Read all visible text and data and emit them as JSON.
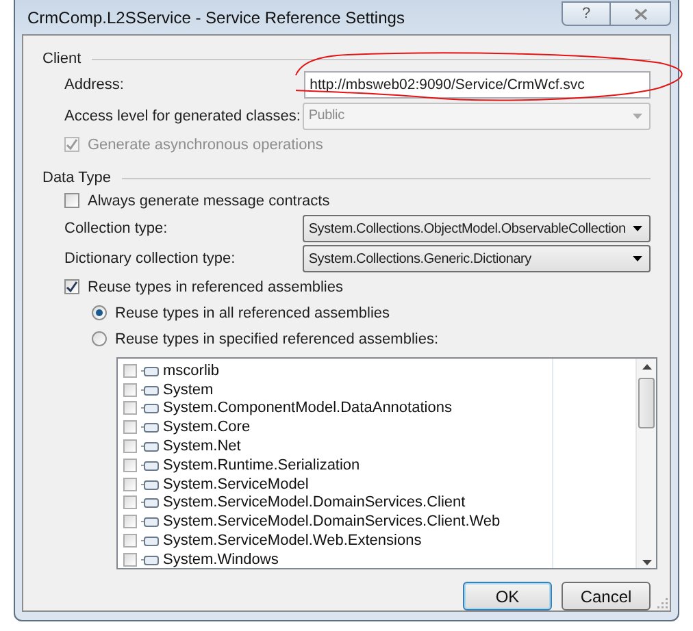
{
  "window": {
    "title": "CrmComp.L2SService - Service Reference Settings",
    "help": "?"
  },
  "client": {
    "legend": "Client",
    "address": {
      "label": "Address:",
      "value": "http://mbsweb02:9090/Service/CrmWcf.svc"
    },
    "access_level": {
      "label": "Access level for generated classes:",
      "value": "Public",
      "disabled": true
    },
    "async": {
      "label": "Generate asynchronous operations",
      "checked": true,
      "disabled": true
    }
  },
  "data_type": {
    "legend": "Data Type",
    "message_contracts": {
      "label": "Always generate message contracts",
      "checked": false
    },
    "collection_type": {
      "label": "Collection type:",
      "value": "System.Collections.ObjectModel.ObservableCollection"
    },
    "dictionary_type": {
      "label": "Dictionary collection type:",
      "value": "System.Collections.Generic.Dictionary"
    },
    "reuse_types": {
      "label": "Reuse types in referenced assemblies",
      "checked": true
    },
    "reuse_options": [
      {
        "label": "Reuse types in all referenced assemblies",
        "selected": true
      },
      {
        "label": "Reuse types in specified referenced assemblies:",
        "selected": false
      }
    ],
    "assemblies": [
      {
        "name": "mscorlib",
        "checked": false
      },
      {
        "name": "System",
        "checked": false
      },
      {
        "name": "System.ComponentModel.DataAnnotations",
        "checked": false
      },
      {
        "name": "System.Core",
        "checked": false
      },
      {
        "name": "System.Net",
        "checked": false
      },
      {
        "name": "System.Runtime.Serialization",
        "checked": false
      },
      {
        "name": "System.ServiceModel",
        "checked": false
      },
      {
        "name": "System.ServiceModel.DomainServices.Client",
        "checked": false
      },
      {
        "name": "System.ServiceModel.DomainServices.Client.Web",
        "checked": false
      },
      {
        "name": "System.ServiceModel.Web.Extensions",
        "checked": false
      },
      {
        "name": "System.Windows",
        "checked": false
      }
    ]
  },
  "buttons": [
    {
      "label": "OK",
      "default": true
    },
    {
      "label": "Cancel",
      "default": false
    }
  ]
}
